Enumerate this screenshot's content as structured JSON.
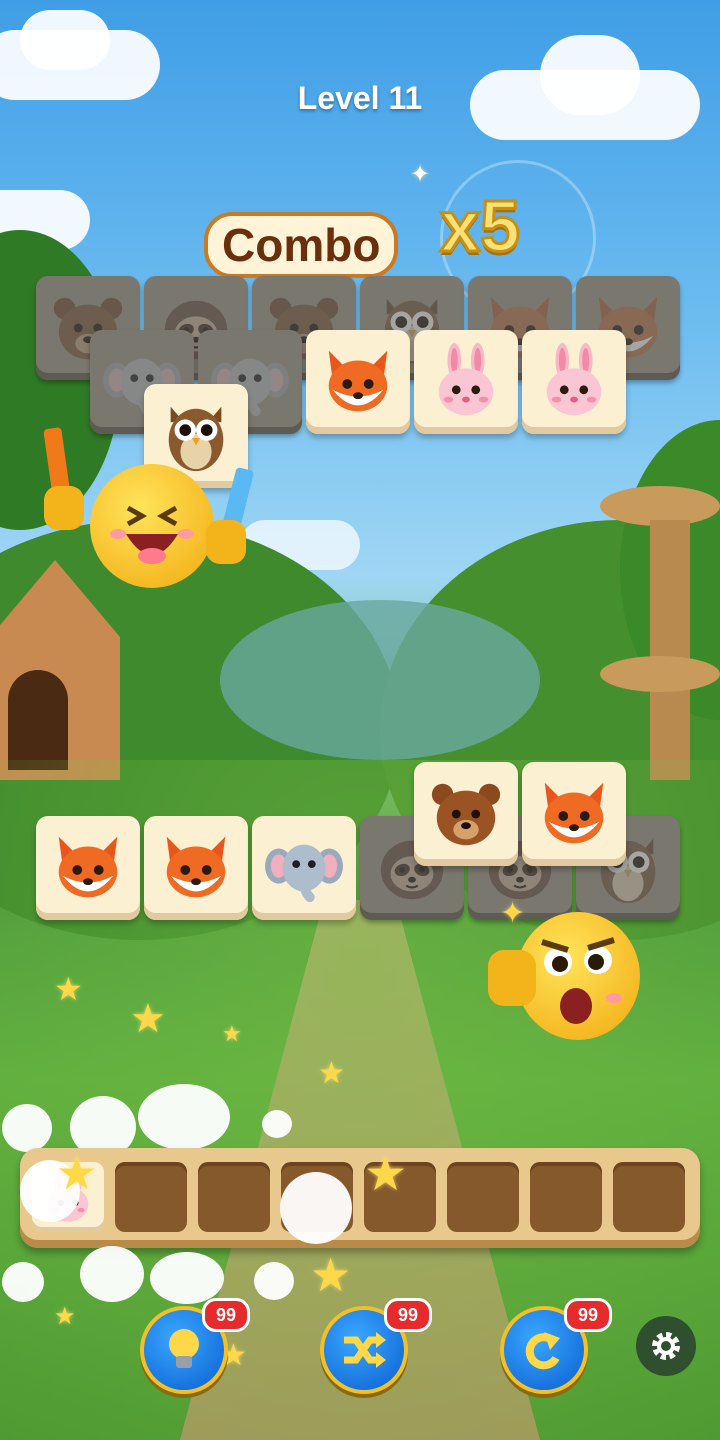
{
  "level": {
    "label": "Level 11"
  },
  "combo": {
    "label": "Combo",
    "multiplier": "x5"
  },
  "board": {
    "top_back_row": [
      "bear",
      "sloth",
      "bear",
      "owl",
      "fox",
      "fox"
    ],
    "top_mid_row": [
      "elephant",
      "elephant",
      "fox",
      "bunny",
      "bunny"
    ],
    "top_front": [
      "owl"
    ],
    "top_active_flags": {
      "mid": [
        false,
        false,
        true,
        true,
        true
      ],
      "back": [
        false,
        false,
        false,
        false,
        false,
        false
      ]
    },
    "bottom_row": [
      "fox",
      "fox",
      "elephant",
      "sloth",
      "sloth",
      "owl"
    ],
    "bottom_row_active": [
      true,
      true,
      true,
      false,
      false,
      false
    ],
    "bottom_top_row": [
      "bear",
      "fox"
    ]
  },
  "tray": {
    "slots": 8,
    "filled": [
      "bunny"
    ]
  },
  "powerups": [
    {
      "name": "hint",
      "icon": "lightbulb-icon",
      "count": "99"
    },
    {
      "name": "shuffle",
      "icon": "shuffle-icon",
      "count": "99"
    },
    {
      "name": "undo",
      "icon": "undo-icon",
      "count": "99"
    }
  ],
  "settings": {
    "icon": "gear-icon"
  },
  "colors": {
    "tile_active": "#fbf0d2",
    "tile_inactive": "#7a776f",
    "tray": "#e9c88e",
    "slot": "#85592c",
    "badge": "#e52b2b"
  }
}
